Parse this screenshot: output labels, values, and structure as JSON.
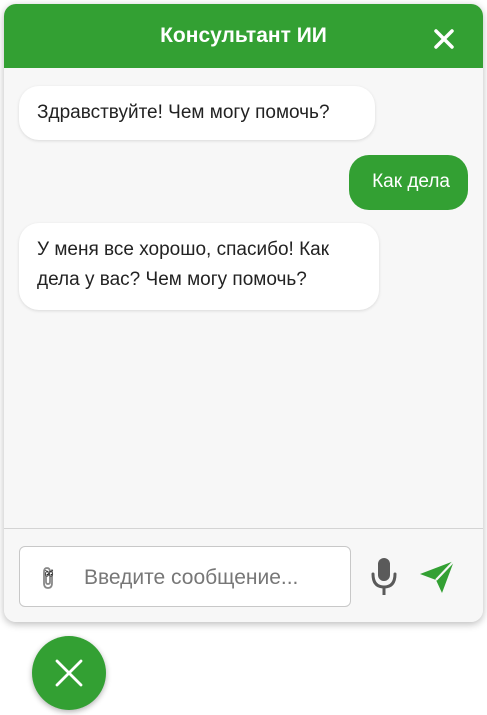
{
  "header": {
    "title": "Консультант ИИ",
    "close_icon": "close-icon"
  },
  "messages": [
    {
      "sender": "bot",
      "text": "Здравствуйте! Чем могу помочь?"
    },
    {
      "sender": "user",
      "text": "Как дела"
    },
    {
      "sender": "bot",
      "text": "У меня все хорошо, спасибо! Как дела у вас? Чем могу помочь?"
    }
  ],
  "composer": {
    "placeholder": "Введите сообщение...",
    "value": "",
    "attach_icon": "paperclip-icon",
    "mic_icon": "microphone-icon",
    "send_icon": "send-icon"
  },
  "fab": {
    "icon": "close-icon"
  },
  "colors": {
    "accent": "#33a033",
    "background": "#f7f7f7",
    "bot_bubble": "#ffffff",
    "user_bubble": "#33a033"
  }
}
